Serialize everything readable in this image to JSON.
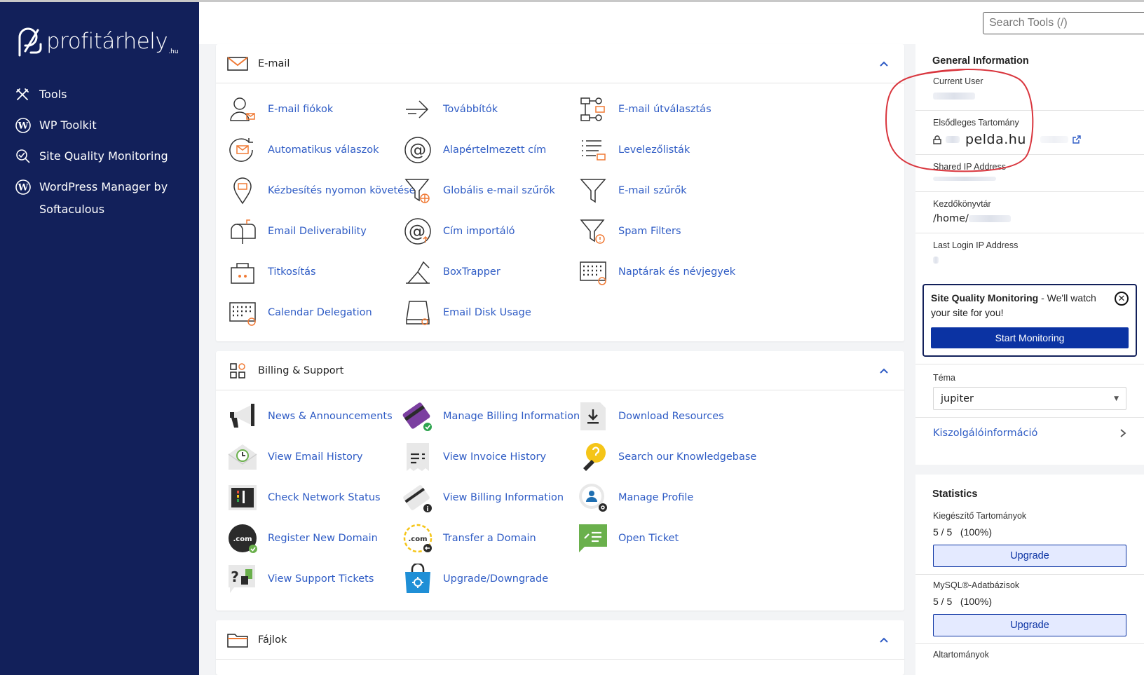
{
  "brand": {
    "name": "profitárhely",
    "tld": ".hu"
  },
  "sidebar": {
    "items": [
      {
        "label": "Tools",
        "icon": "tools-icon"
      },
      {
        "label": "WP Toolkit",
        "icon": "wordpress-icon"
      },
      {
        "label": "Site Quality Monitoring",
        "icon": "site-quality-icon"
      },
      {
        "label": "WordPress Manager by Softaculous",
        "icon": "wordpress-icon"
      }
    ]
  },
  "header": {
    "search_placeholder": "Search Tools (/)"
  },
  "email": {
    "title": "E-mail",
    "tools": [
      "E-mail fiókok",
      "Továbbítók",
      "E-mail útválasztás",
      "Automatikus válaszok",
      "Alapértelmezett cím",
      "Levelezőlisták",
      "Kézbesítés nyomon követése",
      "Globális e-mail szűrők",
      "E-mail szűrők",
      "Email Deliverability",
      "Cím importáló",
      "Spam Filters",
      "Titkosítás",
      "BoxTrapper",
      "Naptárak és névjegyek",
      "Calendar Delegation",
      "Email Disk Usage"
    ]
  },
  "billing": {
    "title": "Billing & Support",
    "tools": [
      "News & Announcements",
      "Manage Billing Information",
      "Download Resources",
      "View Email History",
      "View Invoice History",
      "Search our Knowledgebase",
      "Check Network Status",
      "View Billing Information",
      "Manage Profile",
      "Register New Domain",
      "Transfer a Domain",
      "Open Ticket",
      "View Support Tickets",
      "Upgrade/Downgrade"
    ]
  },
  "files": {
    "title": "Fájlok"
  },
  "general_info": {
    "title": "General Information",
    "current_user_label": "Current User",
    "primary_domain_label": "Elsődleges Tartomány",
    "primary_domain_value": "pelda.hu",
    "shared_ip_label": "Shared IP Address",
    "home_dir_label": "Kezdőkönyvtár",
    "home_dir_value": "/home/",
    "last_login_label": "Last Login IP Address"
  },
  "sqm_banner": {
    "strong": "Site Quality Monitoring",
    "text": " - We'll watch your site for you!",
    "button": "Start Monitoring"
  },
  "theme": {
    "label": "Téma",
    "value": "jupiter"
  },
  "server_info": {
    "label": "Kiszolgálóinformáció"
  },
  "statistics": {
    "title": "Statistics",
    "rows": [
      {
        "label": "Kiegészítő Tartományok",
        "value": "5 / 5   (100%)",
        "button": "Upgrade"
      },
      {
        "label": "MySQL®-Adatbázisok",
        "value": "5 / 5   (100%)",
        "button": "Upgrade"
      }
    ],
    "next_label": "Altartományok"
  },
  "colors": {
    "sidebar": "#12205a",
    "link": "#2f5cc5",
    "primary": "#0b33a3",
    "accent": "#f07a35"
  }
}
